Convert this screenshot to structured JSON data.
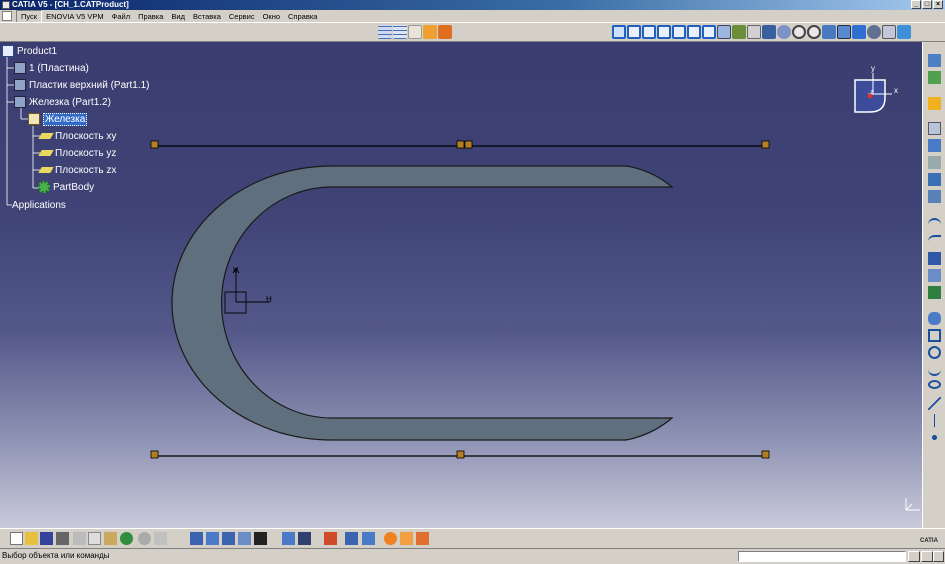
{
  "window": {
    "title": "CATIA V5 - [CH_1.CATProduct]"
  },
  "menubar": {
    "items": [
      "Пуск",
      "ENOVIA V5 VPM",
      "Файл",
      "Правка",
      "Вид",
      "Вставка",
      "Сервис",
      "Окно",
      "Справка"
    ]
  },
  "tree": {
    "nodes": [
      {
        "label": "Product1",
        "icon": "product-icon"
      },
      {
        "label": "1 (Пластина)",
        "icon": "part-instance-icon"
      },
      {
        "label": "Пластик верхний (Part1.1)",
        "icon": "part-instance-icon"
      },
      {
        "label": "Железка (Part1.2)",
        "icon": "part-instance-icon"
      },
      {
        "label": "Железка",
        "icon": "part-icon",
        "selected": true
      },
      {
        "label": "Плоскость xy",
        "icon": "plane-icon"
      },
      {
        "label": "Плоскость yz",
        "icon": "plane-icon"
      },
      {
        "label": "Плоскость zx",
        "icon": "plane-icon"
      },
      {
        "label": "PartBody",
        "icon": "body-gear-icon"
      },
      {
        "label": "Applications",
        "icon": "none"
      }
    ]
  },
  "compass": {
    "x_label": "x",
    "y_label": "y",
    "z_label": "z"
  },
  "sketch_axes": {
    "h_label": "H",
    "v_label": "V"
  },
  "statusbar": {
    "message": "Выбор объекта или команды",
    "command_value": ""
  },
  "logo": {
    "text": "CATIA"
  },
  "colors": {
    "viewport_top": "#3a3d6f",
    "viewport_bottom": "#c9cadb",
    "profile_fill": "#5f6f7e",
    "selection": "#3169c6",
    "tree_line": "#ffffff"
  }
}
